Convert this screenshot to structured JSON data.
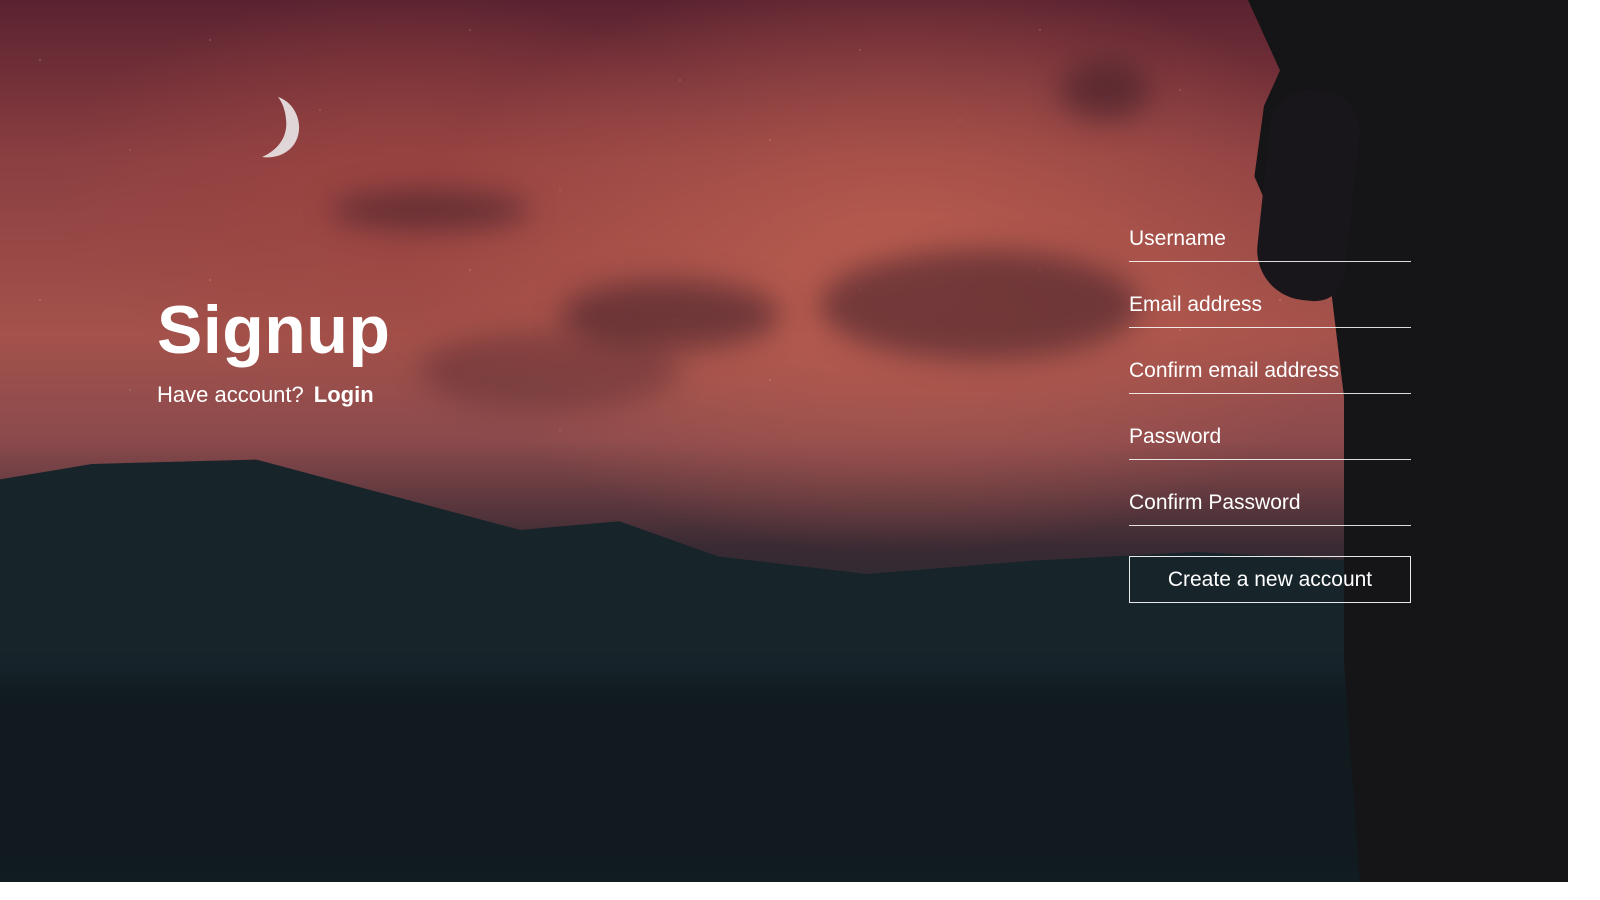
{
  "header": {
    "title": "Signup",
    "have_account_text": "Have account?",
    "login_link": "Login"
  },
  "form": {
    "username_placeholder": "Username",
    "email_placeholder": "Email address",
    "confirm_email_placeholder": "Confirm email address",
    "password_placeholder": "Password",
    "confirm_password_placeholder": "Confirm Password",
    "submit_label": "Create a new account"
  },
  "icons": {
    "moon": "crescent-moon"
  },
  "colors": {
    "text": "#ffffff",
    "sky_top": "#5a2230",
    "sky_glow": "#a4524b",
    "mountains": "#17242a"
  }
}
